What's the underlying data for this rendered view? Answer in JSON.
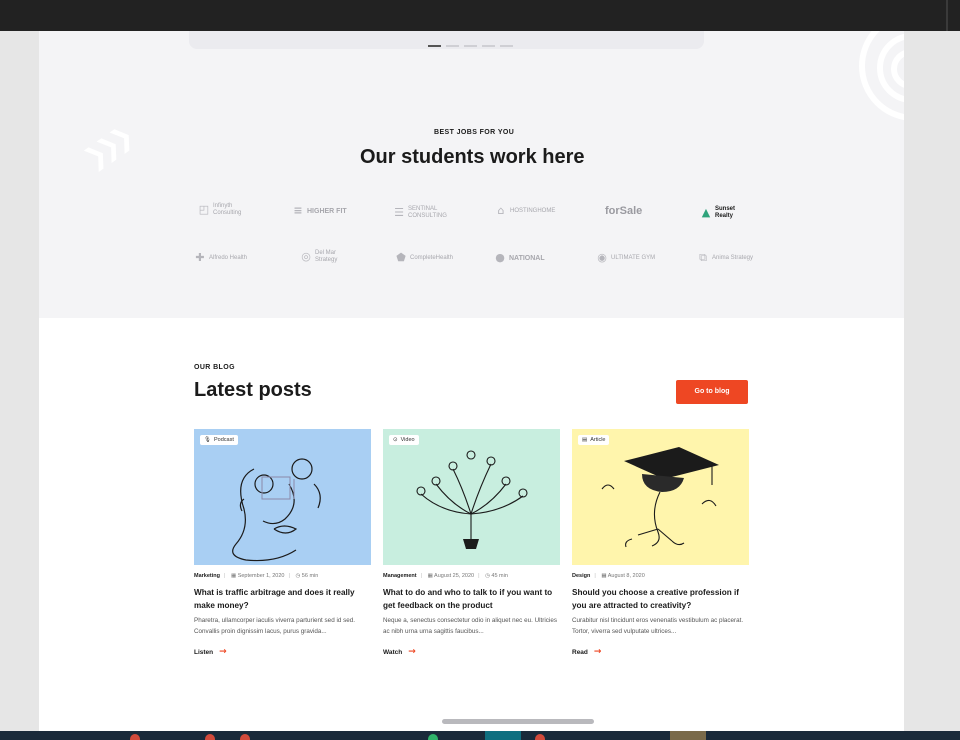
{
  "colors": {
    "accent": "#ee4723",
    "partners_bg": "#f4f4f6",
    "topbar": "#222222"
  },
  "hero": {
    "slide_count": 5,
    "active_slide": 1
  },
  "partners": {
    "eyebrow": "BEST JOBS FOR YOU",
    "title": "Our students work here",
    "logos": [
      {
        "line1": "Infinyth",
        "line2": "Consulting",
        "icon": "square-frame-icon"
      },
      {
        "line1": "HIGHER FIT",
        "line2": "",
        "icon": "lines-icon"
      },
      {
        "line1": "SENTINAL",
        "line2": "CONSULTING",
        "icon": "stripes-icon"
      },
      {
        "line1": "HOSTINGHOME",
        "line2": "",
        "icon": "house-icon"
      },
      {
        "line1": "forSale",
        "line2": "",
        "icon": "tag-icon"
      },
      {
        "line1": "Sunset",
        "line2": "Realty",
        "icon": "house-roof-icon"
      },
      {
        "line1": "Alfredo Health",
        "line2": "",
        "icon": "cross-icon"
      },
      {
        "line1": "Del Mar",
        "line2": "Strategy",
        "icon": "swirl-icon"
      },
      {
        "line1": "CompleteHealth",
        "line2": "",
        "icon": "shield-icon"
      },
      {
        "line1": "NATIONAL",
        "line2": "",
        "icon": "circle-icon"
      },
      {
        "line1": "ULTIMATE GYM",
        "line2": "",
        "icon": "ring-icon"
      },
      {
        "line1": "Anima Strategy",
        "line2": "",
        "icon": "squares-icon"
      }
    ]
  },
  "blog": {
    "eyebrow": "OUR BLOG",
    "title": "Latest posts",
    "button_label": "Go to blog",
    "posts": [
      {
        "badge": "Podcast",
        "badge_icon": "mic-icon",
        "category": "Marketing",
        "date": "September 1, 2020",
        "duration": "56 min",
        "title": "What is traffic arbitrage and does it really make money?",
        "excerpt": "Pharetra, ullamcorper iaculis viverra parturient sed id sed. Convallis proin dignissim lacus, purus gravida...",
        "link": "Listen",
        "bg": "#a9cff3"
      },
      {
        "badge": "Video",
        "badge_icon": "play-icon",
        "category": "Management",
        "date": "August 25, 2020",
        "duration": "45 min",
        "title": "What to do and who to talk to if you want to get feedback on the product",
        "excerpt": "Neque a, senectus consectetur odio in aliquet nec eu. Ultricies ac nibh urna urna sagittis faucibus...",
        "link": "Watch",
        "bg": "#c8eedf"
      },
      {
        "badge": "Article",
        "badge_icon": "document-icon",
        "category": "Design",
        "date": "August 8, 2020",
        "duration": "",
        "title": "Should you choose a creative profession if you are attracted to creativity?",
        "excerpt": "Curabitur nisl tincidunt eros venenatis vestibulum ac placerat. Tortor, viverra sed vulputate ultrices...",
        "link": "Read",
        "bg": "#fff5ac"
      }
    ]
  }
}
